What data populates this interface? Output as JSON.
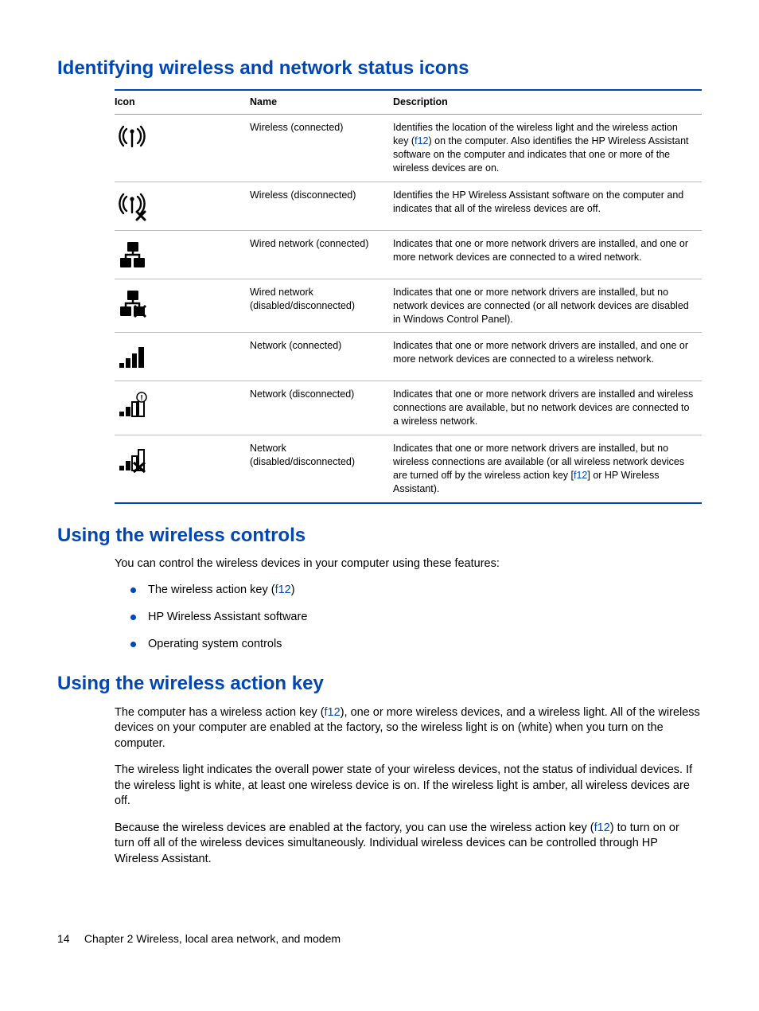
{
  "section1": {
    "title": "Identifying wireless and network status icons",
    "columns": {
      "c1": "Icon",
      "c2": "Name",
      "c3": "Description"
    },
    "rows": [
      {
        "name": "Wireless (connected)",
        "desc_pre": "Identifies the location of the wireless light and the wireless action key (",
        "desc_key": "f12",
        "desc_post": ") on the computer. Also identifies the HP Wireless Assistant software on the computer and indicates that one or more of the wireless devices are on."
      },
      {
        "name": "Wireless (disconnected)",
        "desc": "Identifies the HP Wireless Assistant software on the computer and indicates that all of the wireless devices are off."
      },
      {
        "name": "Wired network (connected)",
        "desc": "Indicates that one or more network drivers are installed, and one or more network devices are connected to a wired network."
      },
      {
        "name": "Wired network (disabled/disconnected)",
        "desc": "Indicates that one or more network drivers are installed, but no network devices are connected (or all network devices are disabled in Windows Control Panel)."
      },
      {
        "name": "Network (connected)",
        "desc": "Indicates that one or more network drivers are installed, and one or more network devices are connected to a wireless network."
      },
      {
        "name": "Network (disconnected)",
        "desc": "Indicates that one or more network drivers are installed and wireless connections are available, but no network devices are connected to a wireless network."
      },
      {
        "name": "Network (disabled/disconnected)",
        "desc_pre": "Indicates that one or more network drivers are installed, but no wireless connections are available (or all wireless network devices are turned off by the wireless action key [",
        "desc_key": "f12",
        "desc_post": "] or HP Wireless Assistant)."
      }
    ]
  },
  "section2": {
    "title": "Using the wireless controls",
    "intro": "You can control the wireless devices in your computer using these features:",
    "bullets": {
      "b0_pre": "The wireless action key (",
      "b0_key": "f12",
      "b0_post": ")",
      "b1": "HP Wireless Assistant software",
      "b2": "Operating system controls"
    }
  },
  "section3": {
    "title": "Using the wireless action key",
    "p1_pre": "The computer has a wireless action key (",
    "p1_key": "f12",
    "p1_post": "), one or more wireless devices, and a wireless light. All of the wireless devices on your computer are enabled at the factory, so the wireless light is on (white) when you turn on the computer.",
    "p2": "The wireless light indicates the overall power state of your wireless devices, not the status of individual devices. If the wireless light is white, at least one wireless device is on. If the wireless light is amber, all wireless devices are off.",
    "p3_pre": "Because the wireless devices are enabled at the factory, you can use the wireless action key (",
    "p3_key": "f12",
    "p3_post": ") to turn on or turn off all of the wireless devices simultaneously. Individual wireless devices can be controlled through HP Wireless Assistant."
  },
  "footer": {
    "page": "14",
    "chapter": "Chapter 2   Wireless, local area network, and modem"
  }
}
